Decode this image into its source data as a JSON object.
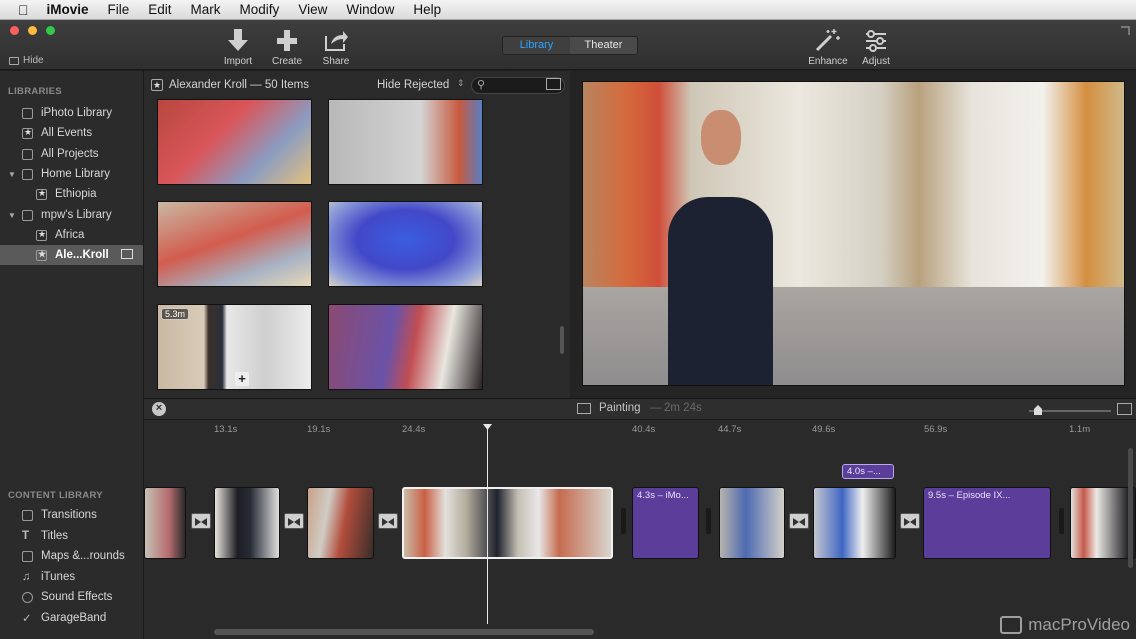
{
  "menubar": {
    "app": "iMovie",
    "items": [
      "File",
      "Edit",
      "Mark",
      "Modify",
      "View",
      "Window",
      "Help"
    ]
  },
  "toolbar": {
    "hide": "Hide",
    "import": "Import",
    "create": "Create",
    "share": "Share",
    "tab_library": "Library",
    "tab_theater": "Theater",
    "enhance": "Enhance",
    "adjust": "Adjust"
  },
  "sidebar": {
    "libraries_heading": "LIBRARIES",
    "items": [
      {
        "label": "iPhoto Library"
      },
      {
        "label": "All Events"
      },
      {
        "label": "All Projects"
      },
      {
        "label": "Home Library"
      },
      {
        "label": "Ethiopia"
      },
      {
        "label": "mpw's Library"
      },
      {
        "label": "Africa"
      },
      {
        "label": "Ale...Kroll"
      }
    ],
    "content_heading": "CONTENT LIBRARY",
    "content_items": [
      {
        "label": "Transitions"
      },
      {
        "label": "Titles"
      },
      {
        "label": "Maps &...rounds"
      },
      {
        "label": "iTunes"
      },
      {
        "label": "Sound Effects"
      },
      {
        "label": "GarageBand"
      }
    ]
  },
  "browser": {
    "event_title": "Alexander Kroll — 50 Items",
    "filter": "Hide Rejected",
    "clip_duration": "5.3m"
  },
  "timeline": {
    "project": "Painting",
    "duration": "2m 24s",
    "ruler": [
      "13.1s",
      "19.1s",
      "24.4s",
      "40.4s",
      "44.7s",
      "49.6s",
      "56.9s",
      "1.1m"
    ],
    "titles": {
      "t1": "4.3s – iMo...",
      "t2": "9.5s – Episode IX...",
      "t3": "4.0s –..."
    }
  },
  "watermark": "macProVideo"
}
